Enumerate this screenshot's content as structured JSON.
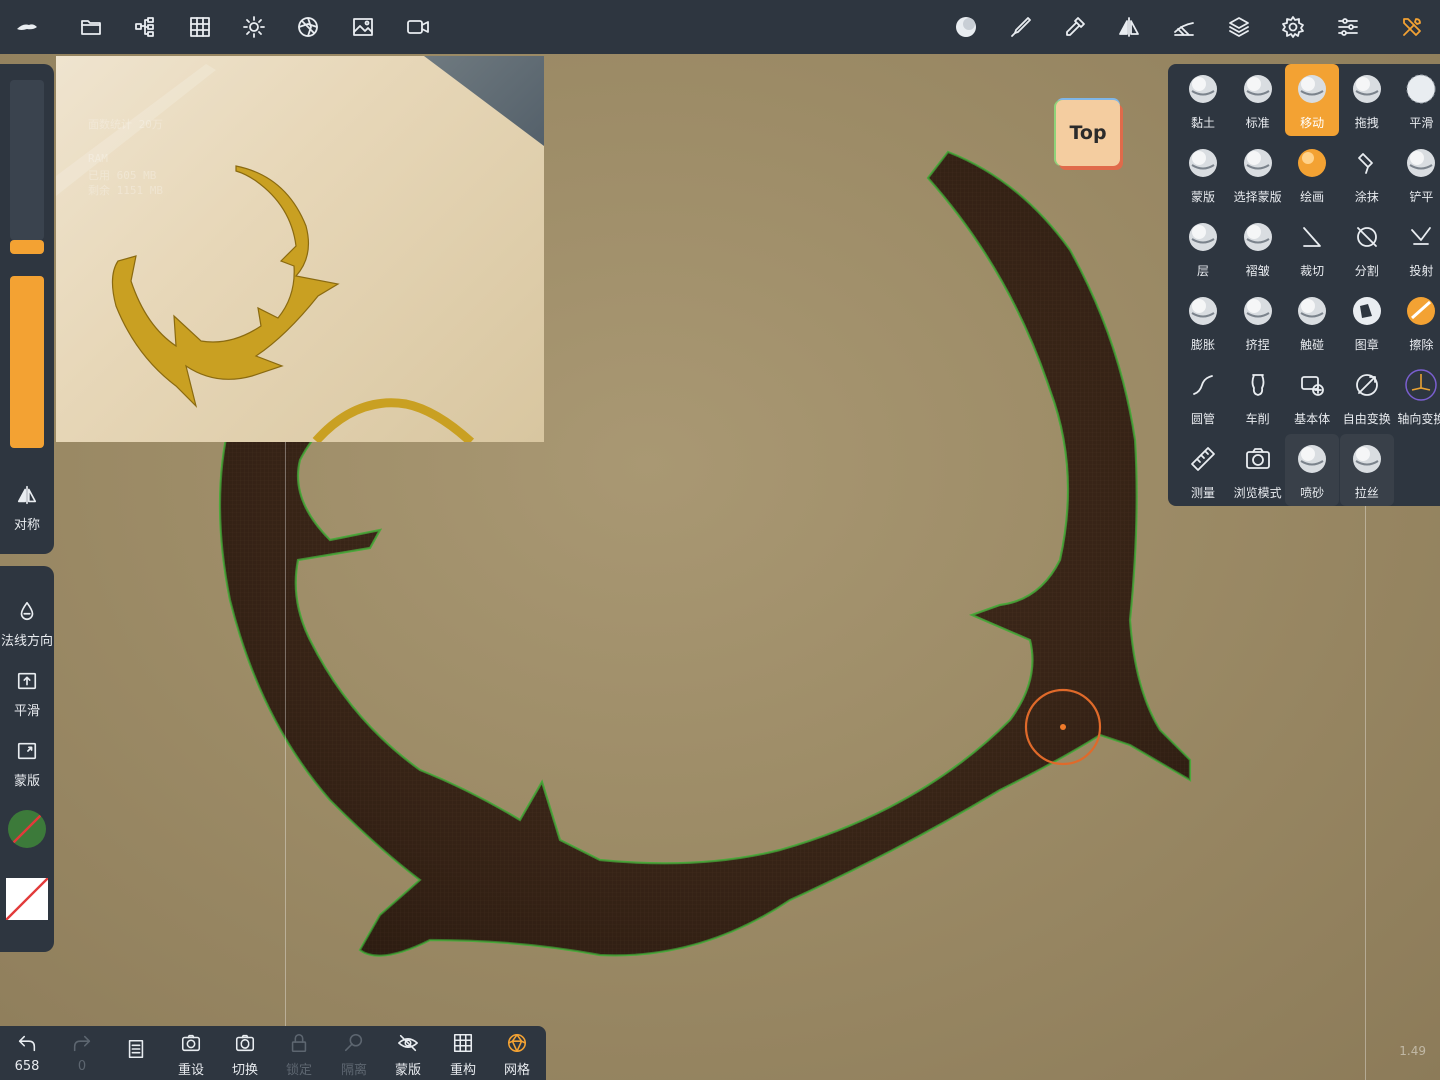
{
  "topbar": {
    "icons": [
      "logo-icon",
      "folder-icon",
      "scene-tree-icon",
      "grid-icon",
      "sun-icon",
      "material-icon",
      "image-icon",
      "video-icon",
      "matcap-icon",
      "brush-icon",
      "pick-icon",
      "symmetry-icon",
      "pen-icon",
      "layers-icon",
      "settings-icon",
      "sliders-icon",
      "tools-icon"
    ]
  },
  "reference_overlay": {
    "lines": [
      "面数统计   20万",
      "RAM",
      "已用    605 MB",
      "剩余    1151 MB"
    ]
  },
  "left_panel": {
    "symmetry_label": "对称",
    "normal_label": "法线方向",
    "smooth_label": "平滑",
    "mask_label": "蒙版",
    "colors": {
      "accent": "#f3a233",
      "swatch_green": "#3c7a3a"
    }
  },
  "view_cube": {
    "label": "Top"
  },
  "tools": [
    {
      "label": "黏土"
    },
    {
      "label": "标准"
    },
    {
      "label": "移动"
    },
    {
      "label": "拖拽"
    },
    {
      "label": "平滑"
    },
    {
      "label": "蒙版"
    },
    {
      "label": "选择蒙版"
    },
    {
      "label": "绘画"
    },
    {
      "label": "涂抹"
    },
    {
      "label": "铲平"
    },
    {
      "label": "层"
    },
    {
      "label": "褶皱"
    },
    {
      "label": "裁切"
    },
    {
      "label": "分割"
    },
    {
      "label": "投射"
    },
    {
      "label": "膨胀"
    },
    {
      "label": "挤捏"
    },
    {
      "label": "触碰"
    },
    {
      "label": "图章"
    },
    {
      "label": "擦除"
    },
    {
      "label": "圆管"
    },
    {
      "label": "车削"
    },
    {
      "label": "基本体"
    },
    {
      "label": "自由变换"
    },
    {
      "label": "轴向变换"
    },
    {
      "label": "测量"
    },
    {
      "label": "浏览模式"
    },
    {
      "label": "喷砂"
    },
    {
      "label": "拉丝"
    }
  ],
  "active_tool": "移动",
  "bottombar": {
    "undo": {
      "label": "658"
    },
    "redo": {
      "label": "0"
    },
    "items": [
      {
        "label": "重设"
      },
      {
        "label": "切换"
      },
      {
        "label": "锁定"
      },
      {
        "label": "隔离"
      },
      {
        "label": "蒙版"
      },
      {
        "label": "重构"
      },
      {
        "label": "网格"
      }
    ]
  },
  "status": {
    "fps": "1.49"
  }
}
